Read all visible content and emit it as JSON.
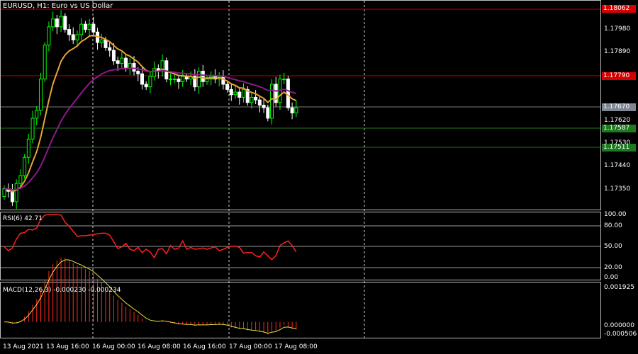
{
  "title": "EURUSD, H1:  Euro vs US Dollar",
  "colors": {
    "background": "#000000",
    "bull": "#00ff00",
    "bear": "#ffffff",
    "ma_fast": "#e6a532",
    "ma_slow": "#8b1a8b",
    "rsi": "#ff2020",
    "macd_hist": "#ff2a1a",
    "macd_signal": "#e8e040",
    "grid": "#cfcfcf",
    "line_red": "#c00000",
    "line_green": "#1a7a1a",
    "line_gray": "#7a7a7a",
    "label_red": "#d50000",
    "label_green": "#1e7a1e",
    "label_gray": "#7f8793"
  },
  "price_axis": {
    "min": 1.1728,
    "max": 1.1808,
    "ticks": [
      "1.17980",
      "1.17890",
      "1.17620",
      "1.17530",
      "1.17440",
      "1.17350"
    ]
  },
  "price_lines": [
    {
      "value": "1.18062",
      "color": "red"
    },
    {
      "value": "1.17790",
      "color": "red"
    },
    {
      "value": "1.17670",
      "color": "gray"
    },
    {
      "value": "1.17587",
      "color": "green"
    },
    {
      "value": "1.17511",
      "color": "green"
    }
  ],
  "rsi": {
    "label": "RSI(6) 42.71",
    "ticks": [
      "100.00",
      "80.00",
      "50.00",
      "20.00",
      "0.00"
    ],
    "values": [
      50,
      44,
      48,
      62,
      71,
      72,
      77,
      76,
      79,
      93,
      99,
      100,
      100,
      100,
      99,
      88,
      82,
      74,
      66,
      67,
      67,
      68,
      69,
      70,
      71,
      71,
      68,
      58,
      47,
      50,
      55,
      46,
      44,
      49,
      41,
      46,
      42,
      33,
      46,
      47,
      39,
      52,
      46,
      48,
      59,
      46,
      49,
      46,
      47,
      48,
      46,
      48,
      50,
      44,
      46,
      49,
      51,
      51,
      49,
      40,
      41,
      41,
      36,
      34,
      42,
      36,
      30,
      36,
      52,
      56,
      59,
      52,
      42
    ]
  },
  "macd": {
    "label": "MACD(12,26,3) -0.000230 -0.000234",
    "ticks": [
      "0.001925",
      "0.000000",
      "-0.000506"
    ],
    "max": 0.001925,
    "min": -0.000506
  },
  "x_labels": [
    "13 Aug 2021",
    "13 Aug 16:00",
    "16 Aug 00:00",
    "16 Aug 08:00",
    "16 Aug 16:00",
    "17 Aug 00:00",
    "17 Aug 08:00"
  ],
  "chart_data": {
    "type": "candlestick",
    "symbol": "EURUSD",
    "timeframe": "H1",
    "candles_close": [
      1.1736,
      1.1735,
      1.1731,
      1.1738,
      1.1741,
      1.1748,
      1.1755,
      1.1763,
      1.1766,
      1.1778,
      1.1791,
      1.1798,
      1.1801,
      1.1798,
      1.1802,
      1.1797,
      1.1795,
      1.1793,
      1.1795,
      1.1799,
      1.1797,
      1.1799,
      1.1796,
      1.1792,
      1.1793,
      1.179,
      1.1789,
      1.1785,
      1.1784,
      1.1786,
      1.1782,
      1.1784,
      1.1781,
      1.178,
      1.1776,
      1.1775,
      1.1779,
      1.1782,
      1.1781,
      1.1785,
      1.1778,
      1.1778,
      1.1778,
      1.1777,
      1.1779,
      1.1778,
      1.1779,
      1.1775,
      1.1781,
      1.1777,
      1.1778,
      1.1779,
      1.1778,
      1.1779,
      1.1776,
      1.1774,
      1.1772,
      1.1773,
      1.1771,
      1.1774,
      1.1769,
      1.1771,
      1.177,
      1.1768,
      1.1767,
      1.1763,
      1.1776,
      1.1769,
      1.1778,
      1.1778,
      1.1767,
      1.1765,
      1.1767
    ]
  }
}
